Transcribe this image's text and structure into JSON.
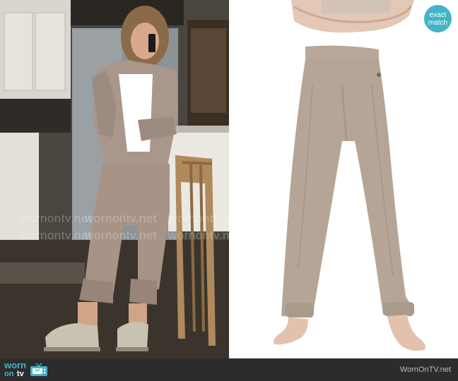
{
  "badge": {
    "line1": "exact",
    "line2": "match"
  },
  "watermark": {
    "line1": "wornontv.net",
    "line2": "wornontv.net"
  },
  "footer": {
    "logo_worn": "worn",
    "logo_on": "on",
    "logo_tv": "tv",
    "site_url": "WornOnTV.net"
  },
  "colors": {
    "brand_teal": "#45b3c5",
    "footer_bg": "#2c2c2c",
    "pants_taupe": "#b5a597"
  }
}
